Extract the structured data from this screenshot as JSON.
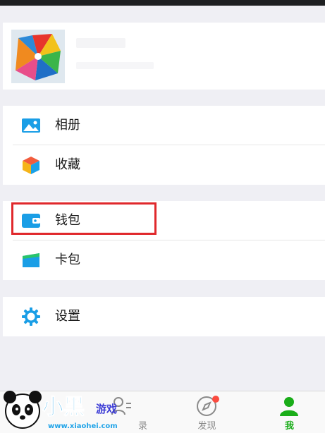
{
  "colors": {
    "accent_green": "#1aad19",
    "highlight_red": "#e0282c",
    "badge_red": "#fa4b3f",
    "icon_blue": "#1a9ee6"
  },
  "menu": {
    "album": {
      "label": "相册",
      "icon": "picture-icon"
    },
    "favorites": {
      "label": "收藏",
      "icon": "cube-icon"
    },
    "wallet": {
      "label": "钱包",
      "icon": "wallet-icon"
    },
    "cards": {
      "label": "卡包",
      "icon": "card-icon"
    },
    "settings": {
      "label": "设置",
      "icon": "gear-icon"
    }
  },
  "tabbar": {
    "contacts": {
      "label": "录"
    },
    "discover": {
      "label": "发现"
    },
    "me": {
      "label": "我"
    }
  },
  "watermark": {
    "logo_text": "小黑游戏",
    "url": "www.xiaohei.com"
  }
}
